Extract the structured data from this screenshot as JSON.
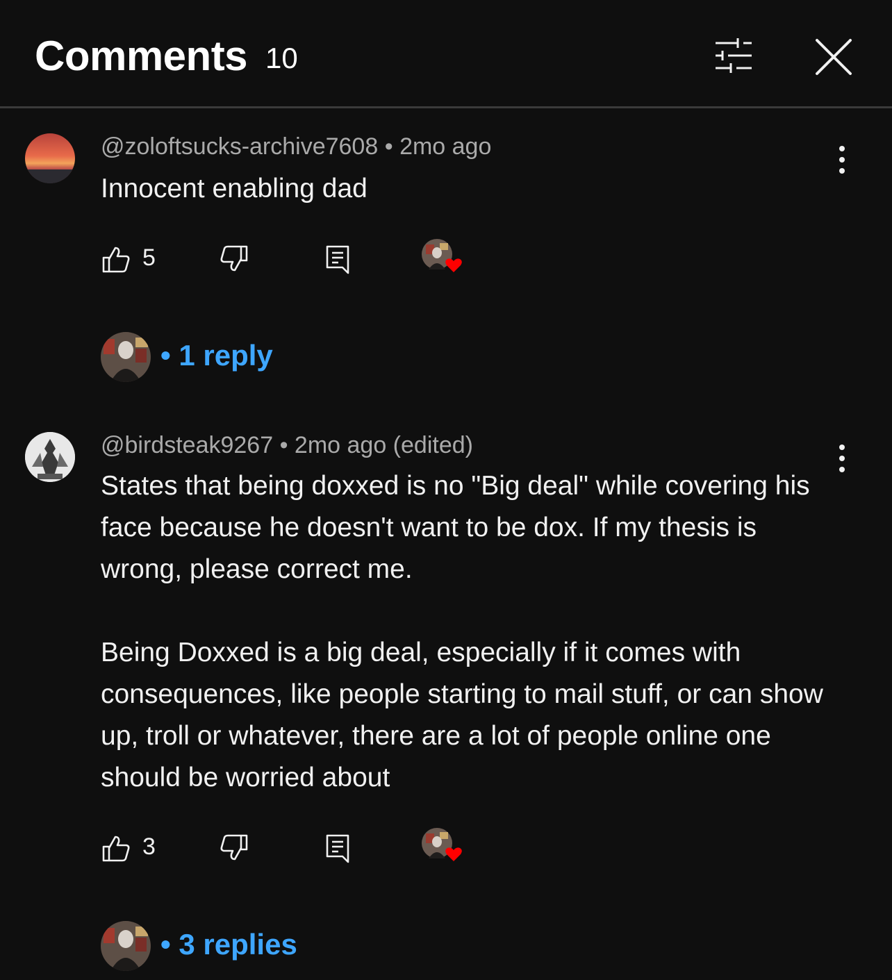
{
  "header": {
    "title": "Comments",
    "count": "10"
  },
  "comments": [
    {
      "author": "@zoloftsucks-archive7608",
      "time": "2mo ago",
      "text": "Innocent enabling dad",
      "likes": "5",
      "replies_label": "1 reply"
    },
    {
      "author": "@birdsteak9267",
      "time": "2mo ago (edited)",
      "text": "States that being doxxed is no \"Big deal\" while covering his face because he doesn't want to be dox. If my thesis is wrong, please correct me.\n\nBeing Doxxed is a big deal, especially if it comes with consequences, like people starting to mail stuff, or can show up, troll or whatever, there are a lot of people online one should be worried about",
      "likes": "3",
      "replies_label": "3 replies"
    }
  ],
  "colors": {
    "background": "#0f0f0f",
    "link": "#3ea6ff",
    "heart": "#ff0000",
    "meta": "#aaaaaa"
  },
  "separator": " • "
}
